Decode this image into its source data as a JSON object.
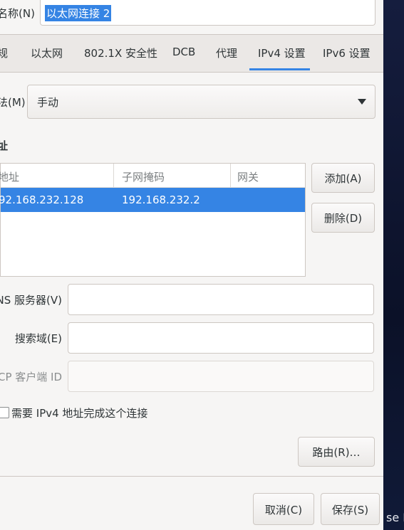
{
  "connection": {
    "name_label": "名称(N)",
    "name_value": "以太网连接 2"
  },
  "tabs": [
    {
      "label": "常规"
    },
    {
      "label": "以太网"
    },
    {
      "label": "802.1X 安全性"
    },
    {
      "label": "DCB"
    },
    {
      "label": "代理"
    },
    {
      "label": "IPv4 设置",
      "active": true
    },
    {
      "label": "IPv6 设置"
    }
  ],
  "tab_visible": [
    "规",
    "以太网",
    "802.1X 安全性",
    "DCB",
    "代理",
    "IPv4 设置",
    "IPv6 设置"
  ],
  "method": {
    "label": "法(M)",
    "value": "手动"
  },
  "addresses": {
    "title": "址",
    "columns": [
      "地址",
      "子网掩码",
      "网关"
    ],
    "rows": [
      {
        "address": "92.168.232.128",
        "netmask": "192.168.232.2",
        "gateway": "",
        "selected": true
      }
    ],
    "add_button": "添加(A)",
    "delete_button": "删除(D)"
  },
  "dns": {
    "label": "DNS 服务器(V)",
    "value": ""
  },
  "search_domain": {
    "label": "搜索域(E)",
    "value": ""
  },
  "dhcp_client_id": {
    "label": "HCP 客户端 ID",
    "value": ""
  },
  "require_ipv4": {
    "label": "需要 IPv4 地址完成这个连接",
    "checked": false
  },
  "routes_button": "路由(R)…",
  "footer": {
    "cancel": "取消(C)",
    "save": "保存(S)"
  },
  "desktop_text": "se L",
  "colors": {
    "accent": "#3584e4",
    "window_bg": "#f6f5f4",
    "desktop_bg": "#0e1530"
  }
}
